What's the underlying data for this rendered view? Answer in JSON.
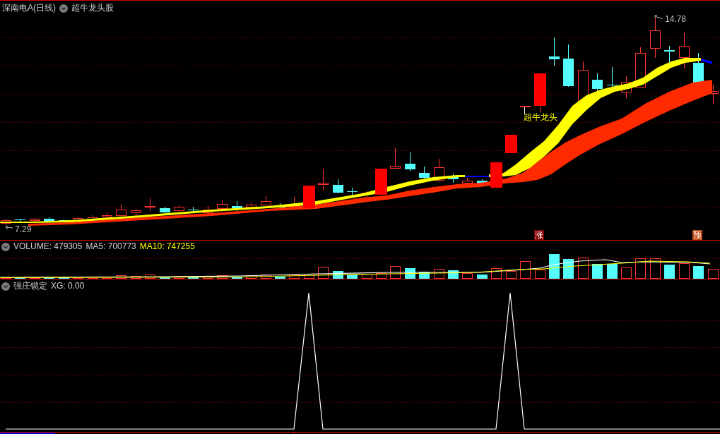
{
  "price_panel": {
    "stock": "深南电A(日线)",
    "indicator": "超牛龙头股",
    "high_label": "14.78",
    "low_label": "7.29",
    "signal_label": "超牛龙头",
    "badges": [
      {
        "text": "涨",
        "color": "#800000"
      },
      {
        "text": "预",
        "color": "#c0480f"
      }
    ]
  },
  "volume_panel": {
    "readouts": [
      {
        "text": "VOLUME: 479305",
        "color": "#d0d0d0"
      },
      {
        "text": "MA5: 700773",
        "color": "#d0d0d0"
      },
      {
        "text": "MA10: 747255",
        "color": "#ffff00"
      }
    ]
  },
  "signal_panel": {
    "indicator": "强庄锁定",
    "readout": "XG: 0.00"
  }
}
